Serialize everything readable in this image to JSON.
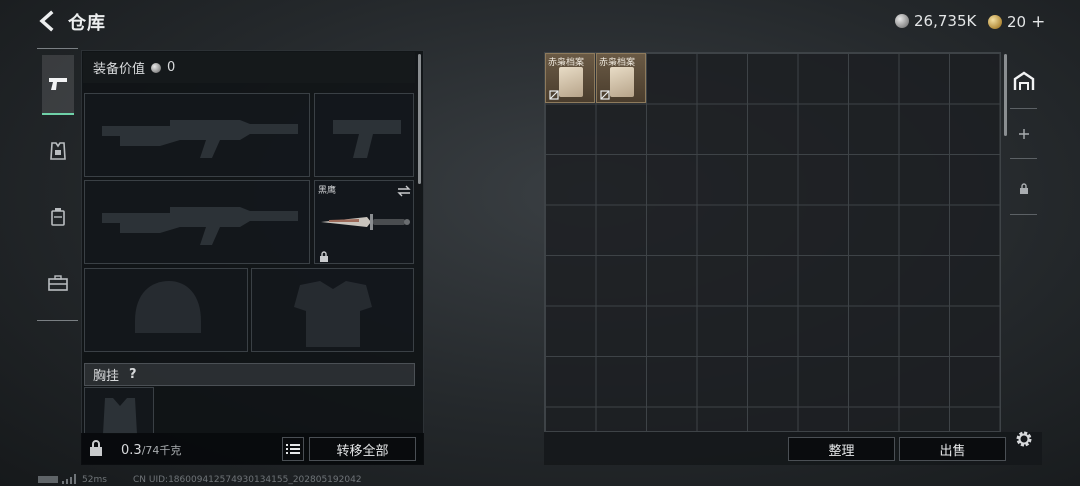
{
  "header": {
    "title": "仓库",
    "silver_amount": "26,735K",
    "gold_amount": "20",
    "gold_plus": "+"
  },
  "equipment": {
    "value_label": "装备价值",
    "value_amount": "0",
    "knife_slot_name": "黑鹰",
    "chest_rig_label": "胸挂",
    "help_symbol": "?"
  },
  "capacity": {
    "current": "0.3",
    "max": "/74千克"
  },
  "buttons": {
    "transfer_all": "转移全部",
    "organize": "整理",
    "sell": "出售"
  },
  "stash": {
    "items": [
      {
        "name": "赤枭档案"
      },
      {
        "name": "赤枭档案"
      }
    ]
  },
  "footer": {
    "ping": "52ms",
    "uid": "CN UID:18600941257493013415​5_202805192042"
  },
  "colors": {
    "accent_green": "#6fd1a8",
    "item_bg": "#5a4b38"
  }
}
